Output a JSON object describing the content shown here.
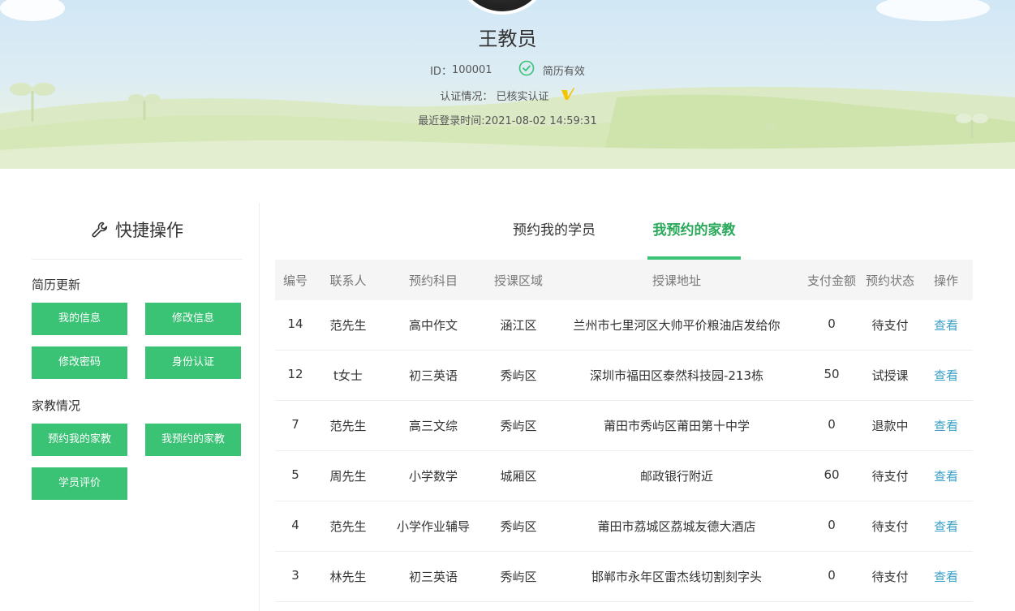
{
  "profile": {
    "name": "王教员",
    "id_label": "ID：",
    "id_value": "100001",
    "resume_status": "简历有效",
    "cert_label": "认证情况：",
    "cert_value": "已核实认证",
    "last_login": "最近登录时间:2021-08-02 14:59:31"
  },
  "sidebar": {
    "title": "快捷操作",
    "sections": [
      {
        "label": "简历更新",
        "buttons": [
          "我的信息",
          "修改信息",
          "修改密码",
          "身份认证"
        ]
      },
      {
        "label": "家教情况",
        "buttons": [
          "预约我的家教",
          "我预约的家教",
          "学员评价"
        ]
      }
    ]
  },
  "tabs": [
    {
      "label": "预约我的学员",
      "active": false
    },
    {
      "label": "我预约的家教",
      "active": true
    }
  ],
  "table": {
    "headers": [
      "编号",
      "联系人",
      "预约科目",
      "授课区域",
      "授课地址",
      "支付金额",
      "预约状态",
      "操作"
    ],
    "rows": [
      [
        "14",
        "范先生",
        "高中作文",
        "涵江区",
        "兰州市七里河区大帅平价粮油店发给你",
        "0",
        "待支付",
        "查看"
      ],
      [
        "12",
        "t女士",
        "初三英语",
        "秀屿区",
        "深圳市福田区泰然科技园-213栋",
        "50",
        "试授课",
        "查看"
      ],
      [
        "7",
        "范先生",
        "高三文综",
        "秀屿区",
        "莆田市秀屿区莆田第十中学",
        "0",
        "退款中",
        "查看"
      ],
      [
        "5",
        "周先生",
        "小学数学",
        "城厢区",
        "邮政银行附近",
        "60",
        "待支付",
        "查看"
      ],
      [
        "4",
        "范先生",
        "小学作业辅导",
        "秀屿区",
        "莆田市荔城区荔城友德大酒店",
        "0",
        "待支付",
        "查看"
      ],
      [
        "3",
        "林先生",
        "初三英语",
        "秀屿区",
        "邯郸市永年区雷杰线切割刻字头",
        "0",
        "待支付",
        "查看"
      ]
    ]
  },
  "colors": {
    "accent": "#3ac275",
    "tab_active": "#2aa95a",
    "link": "#3aa0c9"
  }
}
